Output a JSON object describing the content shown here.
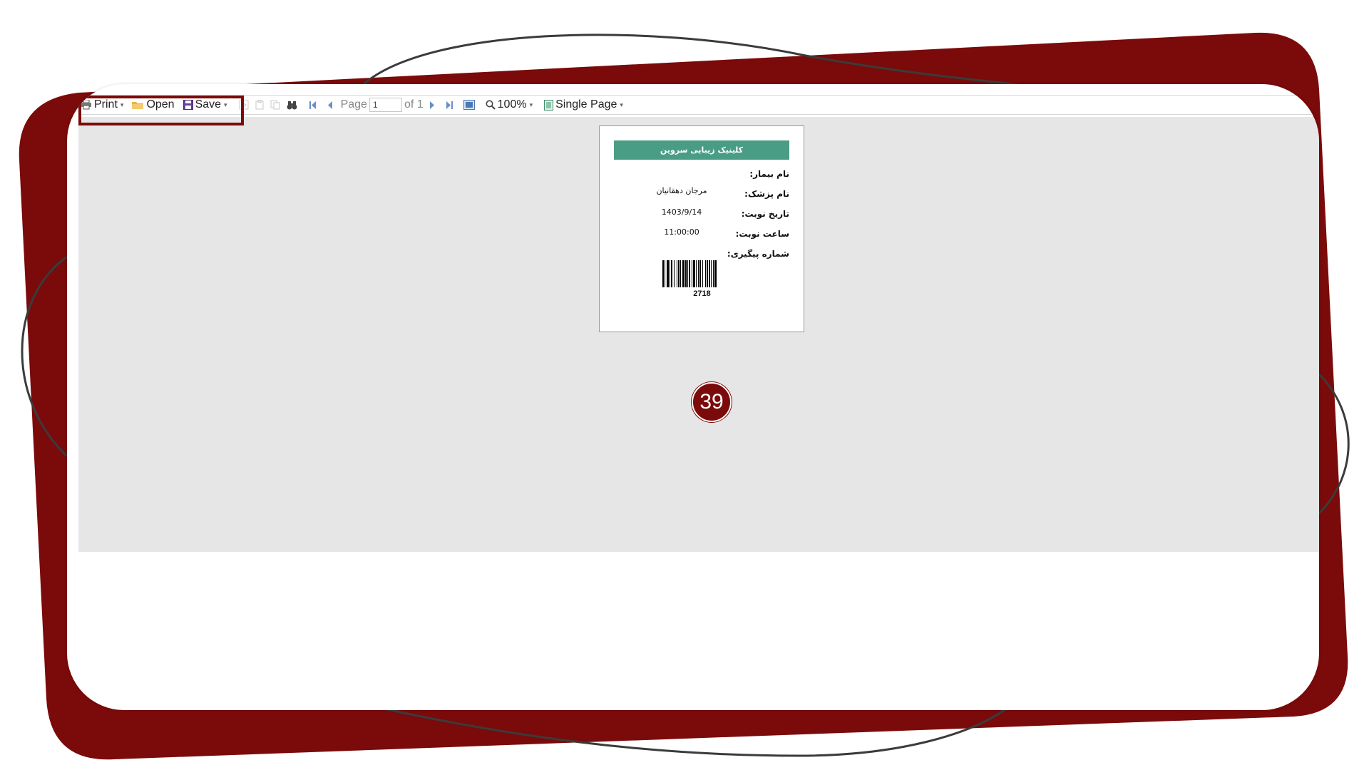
{
  "colors": {
    "accent": "#7b0a0a",
    "header_green": "#4a9d85",
    "viewer_bg": "#e6e6e6"
  },
  "toolbar": {
    "print_label": "Print",
    "open_label": "Open",
    "save_label": "Save",
    "page_label": "Page",
    "page_value": "1",
    "page_of": "of 1",
    "zoom_label": "100%",
    "view_mode_label": "Single Page"
  },
  "report": {
    "header": "کلینیک زیبایی سروین",
    "fields": [
      {
        "label": "نام بیمار:",
        "value": ""
      },
      {
        "label": "نام پزشک:",
        "value": "مرجان دهقانیان"
      },
      {
        "label": "تاریخ نوبت:",
        "value": "1403/9/14"
      },
      {
        "label": "ساعت نوبت:",
        "value": "11:00:00"
      },
      {
        "label": "شماره پیگیری:",
        "value": ""
      }
    ],
    "barcode_number": "2718"
  },
  "step_badge": "39"
}
